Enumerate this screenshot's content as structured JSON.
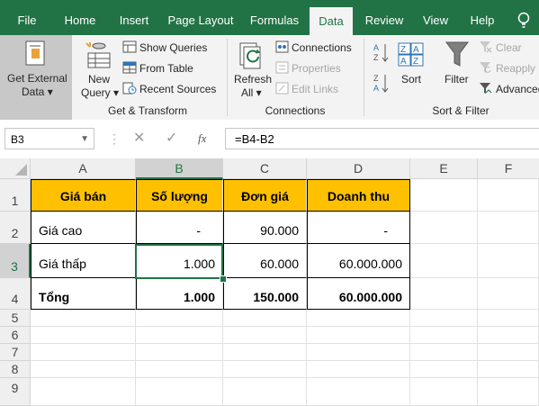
{
  "tabs": [
    "File",
    "Home",
    "Insert",
    "Page Layout",
    "Formulas",
    "Data",
    "Review",
    "View",
    "Help"
  ],
  "ribbon": {
    "get_external_data": [
      "Get External",
      "Data"
    ],
    "new_query": [
      "New",
      "Query"
    ],
    "show_queries": "Show Queries",
    "from_table": "From Table",
    "recent_sources": "Recent Sources",
    "group_get_transform": "Get & Transform",
    "refresh_all": [
      "Refresh",
      "All"
    ],
    "connections": "Connections",
    "properties": "Properties",
    "edit_links": "Edit Links",
    "group_connections": "Connections",
    "sort": "Sort",
    "filter": "Filter",
    "clear": "Clear",
    "reapply": "Reapply",
    "advanced": "Advanced",
    "group_sort_filter": "Sort & Filter"
  },
  "formula_bar": {
    "name_box": "B3",
    "fx": "fx",
    "formula": "=B4-B2"
  },
  "columns": [
    "A",
    "B",
    "C",
    "D",
    "E",
    "F"
  ],
  "rows": [
    "1",
    "2",
    "3",
    "4",
    "5",
    "6",
    "7",
    "8",
    "9"
  ],
  "cells": {
    "A1": "Giá bán",
    "B1": "Số lượng",
    "C1": "Đơn giá",
    "D1": "Doanh thu",
    "A2": "Giá cao",
    "B2": "-",
    "C2": "90.000",
    "D2": "-",
    "A3": "Giá thấp",
    "B3": "1.000",
    "C3": "60.000",
    "D3": "60.000.000",
    "A4": "Tổng",
    "B4": "1.000",
    "C4": "150.000",
    "D4": "60.000.000"
  },
  "colors": {
    "excel_green": "#217346",
    "header_fill": "#ffc000"
  }
}
